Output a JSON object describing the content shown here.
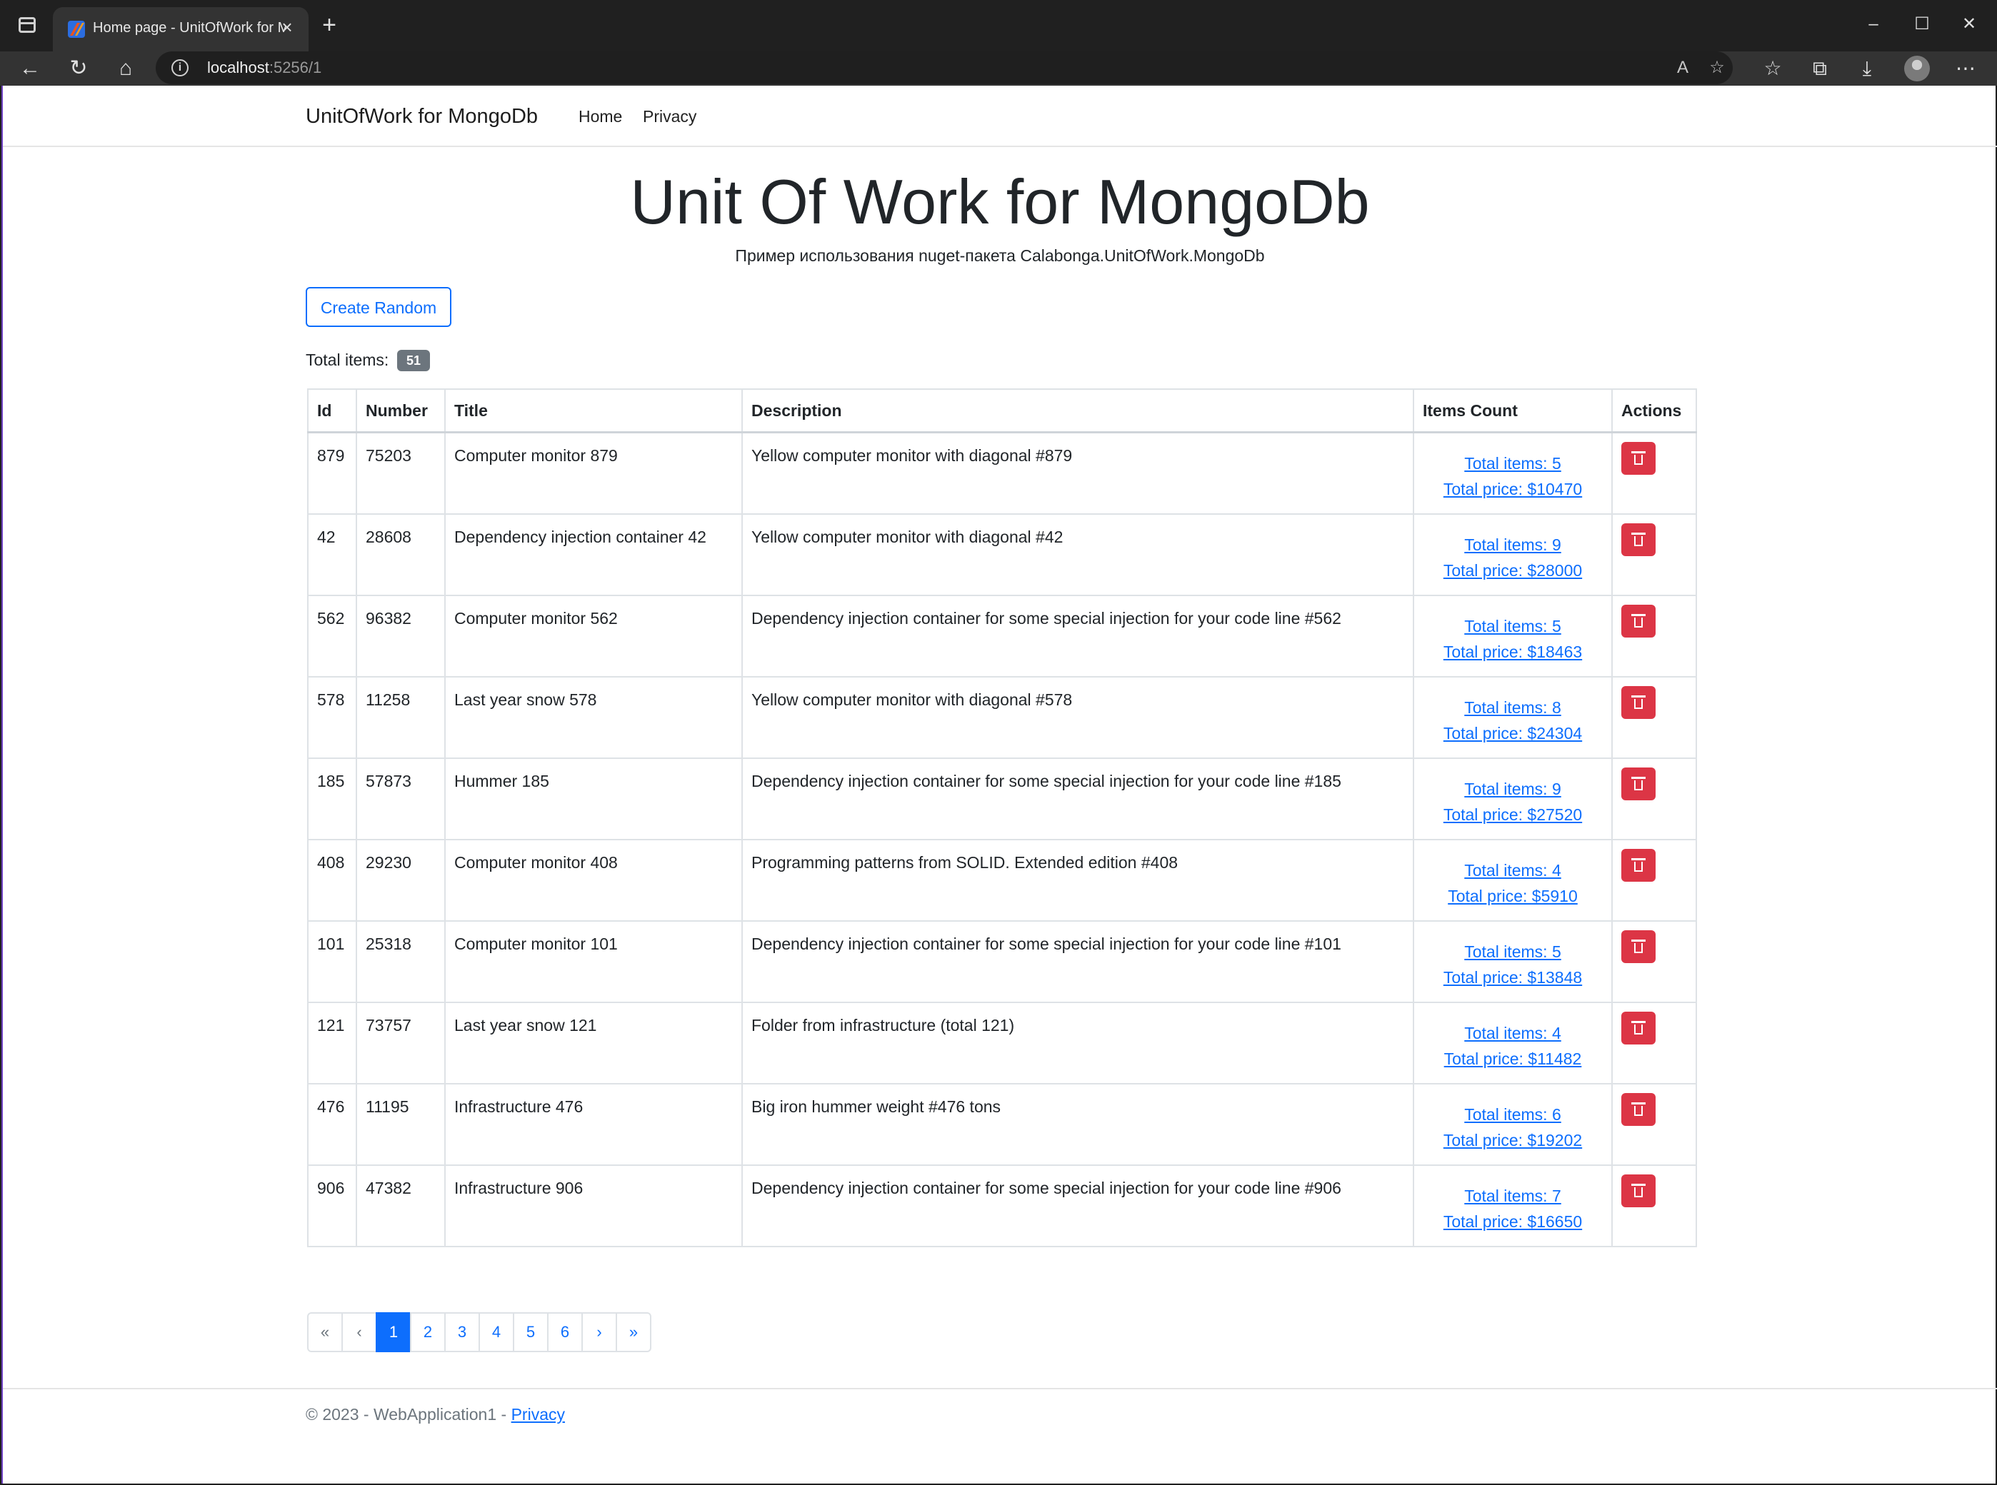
{
  "browser": {
    "tab_title": "Home page - UnitOfWork for MongoDb",
    "new_tab": "+",
    "url_host": "localhost",
    "url_port": ":5256/1"
  },
  "navbar": {
    "brand": "UnitOfWork for MongoDb",
    "links": [
      "Home",
      "Privacy"
    ]
  },
  "hero": {
    "title": "Unit Of Work for MongoDb",
    "subtitle": "Пример использования nuget-пакета Calabonga.UnitOfWork.MongoDb"
  },
  "create_button": "Create Random",
  "total": {
    "label": "Total items:",
    "count": "51"
  },
  "table": {
    "columns": [
      "Id",
      "Number",
      "Title",
      "Description",
      "Items Count",
      "Actions"
    ],
    "rows": [
      {
        "id": "879",
        "number": "75203",
        "title": "Computer monitor 879",
        "description": "Yellow computer monitor with diagonal #879",
        "items": "Total items: 5",
        "price": "Total price: $10470"
      },
      {
        "id": "42",
        "number": "28608",
        "title": "Dependency injection container 42",
        "description": "Yellow computer monitor with diagonal #42",
        "items": "Total items: 9",
        "price": "Total price: $28000"
      },
      {
        "id": "562",
        "number": "96382",
        "title": "Computer monitor 562",
        "description": "Dependency injection container for some special injection for your code line #562",
        "items": "Total items: 5",
        "price": "Total price: $18463"
      },
      {
        "id": "578",
        "number": "11258",
        "title": "Last year snow 578",
        "description": "Yellow computer monitor with diagonal #578",
        "items": "Total items: 8",
        "price": "Total price: $24304"
      },
      {
        "id": "185",
        "number": "57873",
        "title": "Hummer 185",
        "description": "Dependency injection container for some special injection for your code line #185",
        "items": "Total items: 9",
        "price": "Total price: $27520"
      },
      {
        "id": "408",
        "number": "29230",
        "title": "Computer monitor 408",
        "description": "Programming patterns from SOLID. Extended edition #408",
        "items": "Total items: 4",
        "price": "Total price: $5910"
      },
      {
        "id": "101",
        "number": "25318",
        "title": "Computer monitor 101",
        "description": "Dependency injection container for some special injection for your code line #101",
        "items": "Total items: 5",
        "price": "Total price: $13848"
      },
      {
        "id": "121",
        "number": "73757",
        "title": "Last year snow 121",
        "description": "Folder from infrastructure (total 121)",
        "items": "Total items: 4",
        "price": "Total price: $11482"
      },
      {
        "id": "476",
        "number": "11195",
        "title": "Infrastructure 476",
        "description": "Big iron hummer weight #476 tons",
        "items": "Total items: 6",
        "price": "Total price: $19202"
      },
      {
        "id": "906",
        "number": "47382",
        "title": "Infrastructure 906",
        "description": "Dependency injection container for some special injection for your code line #906",
        "items": "Total items: 7",
        "price": "Total price: $16650"
      }
    ]
  },
  "pagination": {
    "first": "«",
    "prev": "‹",
    "pages": [
      "1",
      "2",
      "3",
      "4",
      "5",
      "6"
    ],
    "current": "1",
    "next": "›",
    "last": "»"
  },
  "footer": {
    "text": "© 2023 - WebApplication1 - ",
    "privacy": "Privacy"
  },
  "colors": {
    "primary": "#0d6efd",
    "danger": "#dc3545",
    "badge": "#6c757d"
  }
}
